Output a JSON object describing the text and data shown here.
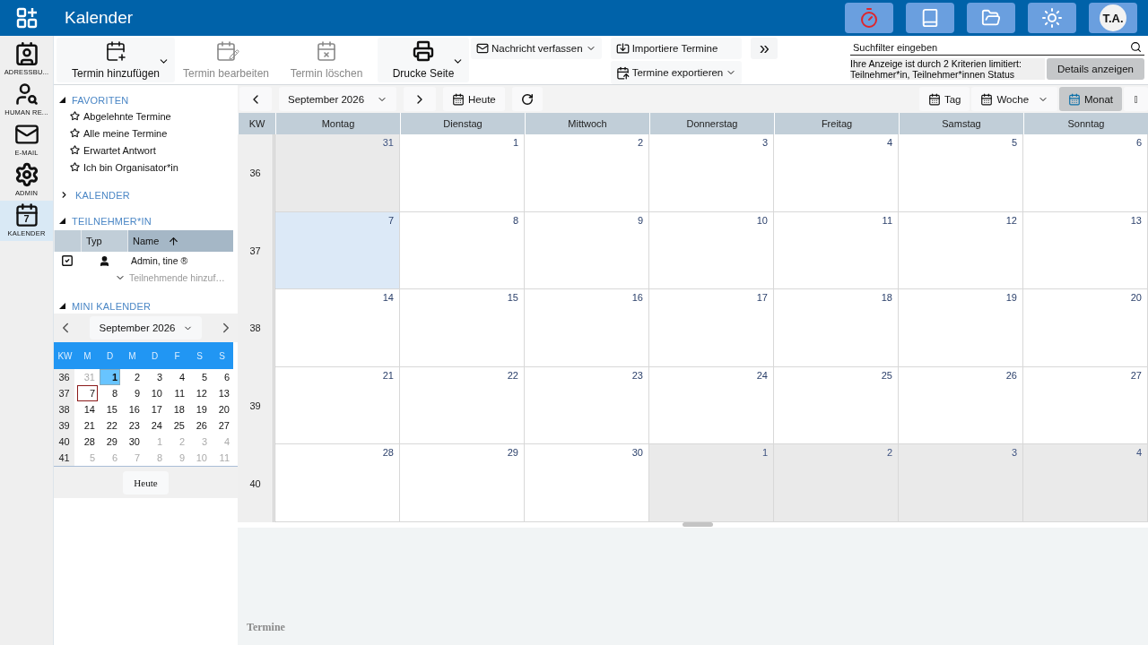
{
  "header": {
    "title": "Kalender",
    "actions": [
      {
        "kind": "timer"
      },
      {
        "kind": "book"
      },
      {
        "kind": "folder"
      },
      {
        "kind": "sun"
      }
    ],
    "avatar": "T.A."
  },
  "app_rail": [
    {
      "label": "ADRESSBU...",
      "kind": "contacts",
      "selected": false
    },
    {
      "label": "HUMAN RE...",
      "kind": "hr",
      "selected": false
    },
    {
      "label": "E-MAIL",
      "kind": "mail",
      "selected": false
    },
    {
      "label": "ADMIN",
      "kind": "admin",
      "selected": false
    },
    {
      "label": "KALENDER",
      "kind": "calendar",
      "icon_text": "7",
      "selected": true
    }
  ],
  "toolbar": {
    "large_buttons": [
      {
        "label": "Termin hinzufügen",
        "kind": "add",
        "disabled": false,
        "dropdown": true
      },
      {
        "label": "Termin bearbeiten",
        "kind": "edit",
        "disabled": true,
        "dropdown": false
      },
      {
        "label": "Termin löschen",
        "kind": "delete",
        "disabled": true,
        "dropdown": false
      },
      {
        "label": "Drucke Seite",
        "kind": "print",
        "disabled": false,
        "dropdown": true
      }
    ],
    "message_button": {
      "label": "Nachricht verfassen",
      "dropdown": true
    },
    "import_button": {
      "label": "Importiere Termine",
      "dropdown": false
    },
    "export_button": {
      "label": "Termine exportieren",
      "dropdown": true
    },
    "more_button": {
      "label": "»"
    }
  },
  "search": {
    "placeholder": "Suchfilter eingeben",
    "notice": [
      "Ihre Anzeige ist durch 2 Kriterien limitiert:",
      "Teilnehmer*in, Teilnehmer*innen Status"
    ],
    "details_button": "Details anzeigen"
  },
  "sidebar": {
    "favorites": {
      "title": "FAVORITEN",
      "expanded": true,
      "items": [
        "Abgelehnte Termine",
        "Alle meine Termine",
        "Erwartet Antwort",
        "Ich bin Organisator*in"
      ]
    },
    "calendars": {
      "title": "KALENDER",
      "expanded": false
    },
    "attendees": {
      "title": "TEILNEHMER*IN",
      "expanded": true,
      "columns": [
        "Typ",
        "Name"
      ],
      "rows": [
        {
          "name": "Admin, tine ®",
          "checked": true
        }
      ],
      "add_placeholder": "Teilnehmende hinzuf…"
    },
    "mini_calendar": {
      "title": "MINI KALENDER",
      "expanded": true,
      "month": "September 2026",
      "headers": [
        "KW",
        "M",
        "D",
        "M",
        "D",
        "F",
        "S",
        "S"
      ],
      "weeks": [
        {
          "kw": "36",
          "days": [
            {
              "day": "31",
              "in_month": false,
              "selected": false,
              "today": false
            },
            {
              "day": "1",
              "in_month": true,
              "selected": true,
              "today": false
            },
            {
              "day": "2",
              "in_month": true,
              "selected": false,
              "today": false
            },
            {
              "day": "3",
              "in_month": true,
              "selected": false,
              "today": false
            },
            {
              "day": "4",
              "in_month": true,
              "selected": false,
              "today": false
            },
            {
              "day": "5",
              "in_month": true,
              "selected": false,
              "today": false
            },
            {
              "day": "6",
              "in_month": true,
              "selected": false,
              "today": false
            }
          ]
        },
        {
          "kw": "37",
          "days": [
            {
              "day": "7",
              "in_month": true,
              "selected": false,
              "today": true
            },
            {
              "day": "8",
              "in_month": true,
              "selected": false,
              "today": false
            },
            {
              "day": "9",
              "in_month": true,
              "selected": false,
              "today": false
            },
            {
              "day": "10",
              "in_month": true,
              "selected": false,
              "today": false
            },
            {
              "day": "11",
              "in_month": true,
              "selected": false,
              "today": false
            },
            {
              "day": "12",
              "in_month": true,
              "selected": false,
              "today": false
            },
            {
              "day": "13",
              "in_month": true,
              "selected": false,
              "today": false
            }
          ]
        },
        {
          "kw": "38",
          "days": [
            {
              "day": "14",
              "in_month": true,
              "selected": false,
              "today": false
            },
            {
              "day": "15",
              "in_month": true,
              "selected": false,
              "today": false
            },
            {
              "day": "16",
              "in_month": true,
              "selected": false,
              "today": false
            },
            {
              "day": "17",
              "in_month": true,
              "selected": false,
              "today": false
            },
            {
              "day": "18",
              "in_month": true,
              "selected": false,
              "today": false
            },
            {
              "day": "19",
              "in_month": true,
              "selected": false,
              "today": false
            },
            {
              "day": "20",
              "in_month": true,
              "selected": false,
              "today": false
            }
          ]
        },
        {
          "kw": "39",
          "days": [
            {
              "day": "21",
              "in_month": true,
              "selected": false,
              "today": false
            },
            {
              "day": "22",
              "in_month": true,
              "selected": false,
              "today": false
            },
            {
              "day": "23",
              "in_month": true,
              "selected": false,
              "today": false
            },
            {
              "day": "24",
              "in_month": true,
              "selected": false,
              "today": false
            },
            {
              "day": "25",
              "in_month": true,
              "selected": false,
              "today": false
            },
            {
              "day": "26",
              "in_month": true,
              "selected": false,
              "today": false
            },
            {
              "day": "27",
              "in_month": true,
              "selected": false,
              "today": false
            }
          ]
        },
        {
          "kw": "40",
          "days": [
            {
              "day": "28",
              "in_month": true,
              "selected": false,
              "today": false
            },
            {
              "day": "29",
              "in_month": true,
              "selected": false,
              "today": false
            },
            {
              "day": "30",
              "in_month": true,
              "selected": false,
              "today": false
            },
            {
              "day": "1",
              "in_month": false,
              "selected": false,
              "today": false
            },
            {
              "day": "2",
              "in_month": false,
              "selected": false,
              "today": false
            },
            {
              "day": "3",
              "in_month": false,
              "selected": false,
              "today": false
            },
            {
              "day": "4",
              "in_month": false,
              "selected": false,
              "today": false
            }
          ]
        },
        {
          "kw": "41",
          "days": [
            {
              "day": "5",
              "in_month": false,
              "selected": false,
              "today": false
            },
            {
              "day": "6",
              "in_month": false,
              "selected": false,
              "today": false
            },
            {
              "day": "7",
              "in_month": false,
              "selected": false,
              "today": false
            },
            {
              "day": "8",
              "in_month": false,
              "selected": false,
              "today": false
            },
            {
              "day": "9",
              "in_month": false,
              "selected": false,
              "today": false
            },
            {
              "day": "10",
              "in_month": false,
              "selected": false,
              "today": false
            },
            {
              "day": "11",
              "in_month": false,
              "selected": false,
              "today": false
            }
          ]
        }
      ],
      "today_button": "Heute"
    }
  },
  "calendar": {
    "period": "September 2026",
    "today_button": "Heute",
    "views": [
      {
        "label": "Tag",
        "selected": false,
        "dropdown": false
      },
      {
        "label": "Woche",
        "selected": false,
        "dropdown": true
      },
      {
        "label": "Monat",
        "selected": true,
        "dropdown": false
      }
    ],
    "columns": [
      "KW",
      "Montag",
      "Dienstag",
      "Mittwoch",
      "Donnerstag",
      "Freitag",
      "Samstag",
      "Sonntag"
    ],
    "weeks": [
      {
        "kw": "36",
        "days": [
          {
            "day": "31",
            "in_month": false,
            "today": false
          },
          {
            "day": "1",
            "in_month": true,
            "today": false
          },
          {
            "day": "2",
            "in_month": true,
            "today": false
          },
          {
            "day": "3",
            "in_month": true,
            "today": false
          },
          {
            "day": "4",
            "in_month": true,
            "today": false
          },
          {
            "day": "5",
            "in_month": true,
            "today": false
          },
          {
            "day": "6",
            "in_month": true,
            "today": false
          }
        ]
      },
      {
        "kw": "37",
        "days": [
          {
            "day": "7",
            "in_month": true,
            "today": true
          },
          {
            "day": "8",
            "in_month": true,
            "today": false
          },
          {
            "day": "9",
            "in_month": true,
            "today": false
          },
          {
            "day": "10",
            "in_month": true,
            "today": false
          },
          {
            "day": "11",
            "in_month": true,
            "today": false
          },
          {
            "day": "12",
            "in_month": true,
            "today": false
          },
          {
            "day": "13",
            "in_month": true,
            "today": false
          }
        ]
      },
      {
        "kw": "38",
        "days": [
          {
            "day": "14",
            "in_month": true,
            "today": false
          },
          {
            "day": "15",
            "in_month": true,
            "today": false
          },
          {
            "day": "16",
            "in_month": true,
            "today": false
          },
          {
            "day": "17",
            "in_month": true,
            "today": false
          },
          {
            "day": "18",
            "in_month": true,
            "today": false
          },
          {
            "day": "19",
            "in_month": true,
            "today": false
          },
          {
            "day": "20",
            "in_month": true,
            "today": false
          }
        ]
      },
      {
        "kw": "39",
        "days": [
          {
            "day": "21",
            "in_month": true,
            "today": false
          },
          {
            "day": "22",
            "in_month": true,
            "today": false
          },
          {
            "day": "23",
            "in_month": true,
            "today": false
          },
          {
            "day": "24",
            "in_month": true,
            "today": false
          },
          {
            "day": "25",
            "in_month": true,
            "today": false
          },
          {
            "day": "26",
            "in_month": true,
            "today": false
          },
          {
            "day": "27",
            "in_month": true,
            "today": false
          }
        ]
      },
      {
        "kw": "40",
        "days": [
          {
            "day": "28",
            "in_month": true,
            "today": false
          },
          {
            "day": "29",
            "in_month": true,
            "today": false
          },
          {
            "day": "30",
            "in_month": true,
            "today": false
          },
          {
            "day": "1",
            "in_month": false,
            "today": false
          },
          {
            "day": "2",
            "in_month": false,
            "today": false
          },
          {
            "day": "3",
            "in_month": false,
            "today": false
          },
          {
            "day": "4",
            "in_month": false,
            "today": false
          }
        ]
      }
    ]
  },
  "detail_panel": {
    "title": "Termine"
  }
}
